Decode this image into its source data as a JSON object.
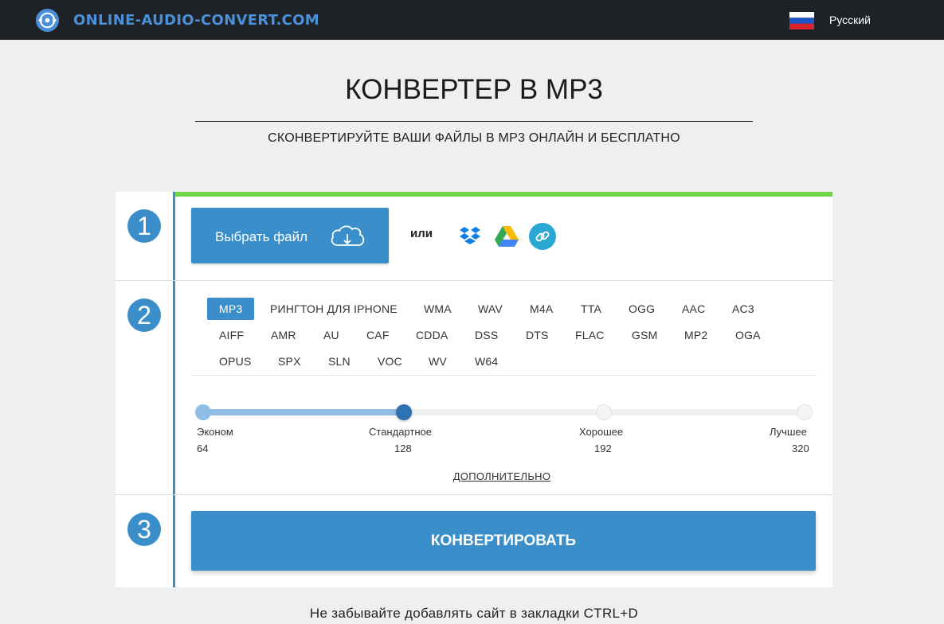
{
  "header": {
    "logo_text": "ONLINE-AUDIO-CONVERT.COM",
    "language": "Русский"
  },
  "hero": {
    "title": "КОНВЕРТЕР В MP3",
    "subtitle": "СКОНВЕРТИРУЙТЕ ВАШИ ФАЙЛЫ В MP3 ОНЛАЙН И БЕСПЛАТНО"
  },
  "steps": [
    "1",
    "2",
    "3"
  ],
  "upload": {
    "choose_file_label": "Выбрать файл",
    "or_label": "или",
    "services": [
      "dropbox-icon",
      "google-drive-icon",
      "url-link-icon"
    ]
  },
  "formats": {
    "active": "MP3",
    "items": [
      "MP3",
      "РИНГТОН ДЛЯ IPHONE",
      "WMA",
      "WAV",
      "M4A",
      "TTA",
      "OGG",
      "AAC",
      "AC3",
      "AIFF",
      "AMR",
      "AU",
      "CAF",
      "CDDA",
      "DSS",
      "DTS",
      "FLAC",
      "GSM",
      "MP2",
      "OGA",
      "OPUS",
      "SPX",
      "SLN",
      "VOC",
      "WV",
      "W64"
    ]
  },
  "quality": {
    "selected_index": 1,
    "levels": [
      {
        "label": "Эконом",
        "value": "64"
      },
      {
        "label": "Стандартное",
        "value": "128"
      },
      {
        "label": "Хорошее",
        "value": "192"
      },
      {
        "label": "Лучшее",
        "value": "320"
      }
    ],
    "more_label": "ДОПОЛНИТЕЛЬНО"
  },
  "convert": {
    "button_label": "КОНВЕРТИРОВАТЬ"
  },
  "footer": {
    "note": "Не забывайте добавлять сайт в закладки CTRL+D"
  },
  "colors": {
    "accent": "#3a8fcb",
    "progress": "#6fd44b",
    "header_bg": "#1e2226",
    "page_bg": "#efefef"
  }
}
